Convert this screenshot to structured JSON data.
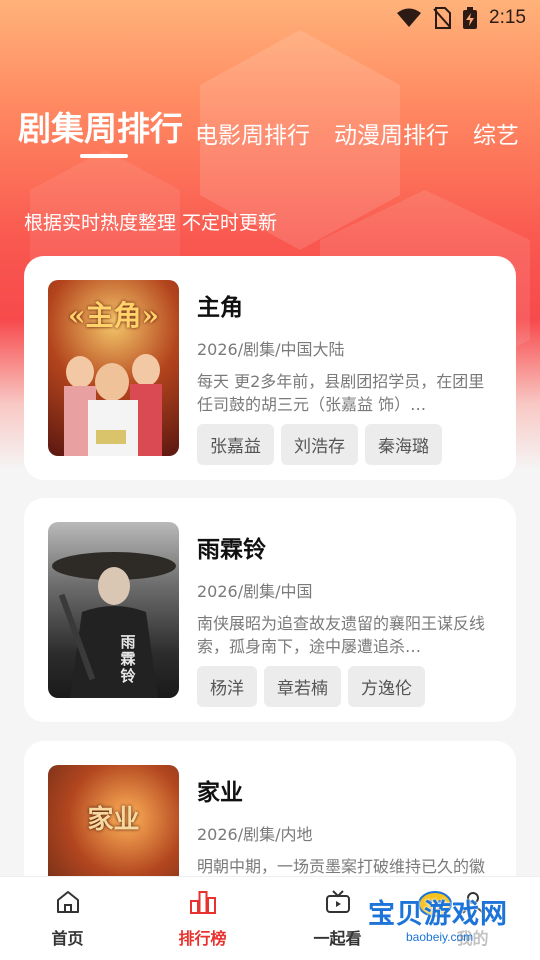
{
  "status_bar": {
    "time": "2:15"
  },
  "tabs": [
    {
      "label": "剧集周排行"
    },
    {
      "label": "电影周排行"
    },
    {
      "label": "动漫周排行"
    },
    {
      "label": "综艺"
    }
  ],
  "subtitle": "根据实时热度整理 不定时更新",
  "cards": [
    {
      "title": "主角",
      "meta": "2026/剧集/中国大陆",
      "desc": "每天 更2多年前，县剧团招学员，在团里任司鼓的胡三元（张嘉益 饰）…",
      "tags": [
        "张嘉益",
        "刘浩存",
        "秦海璐"
      ],
      "poster_text": "«主角»"
    },
    {
      "title": "雨霖铃",
      "meta": "2026/剧集/中国",
      "desc": "南侠展昭为追查故友遗留的襄阳王谋反线索，孤身南下，途中屡遭追杀…",
      "tags": [
        "杨洋",
        "章若楠",
        "方逸伦"
      ],
      "poster_text": "雨霖铃"
    },
    {
      "title": "家业",
      "meta": "2026/剧集/内地",
      "desc": "明朝中期，一场贡墨案打破维持已久的徽州墨业格局，位居龙头的…",
      "tags": [],
      "poster_text": "家业"
    }
  ],
  "bottom_nav": [
    {
      "label": "首页"
    },
    {
      "label": "排行榜"
    },
    {
      "label": "一起看"
    },
    {
      "label": "我的"
    }
  ],
  "watermark": {
    "text": "宝贝游戏网",
    "url": "baobeiy.com"
  },
  "colors": {
    "accent": "#e8322d",
    "hero_top": "#ffb27a",
    "hero_mid": "#f74a4c"
  }
}
